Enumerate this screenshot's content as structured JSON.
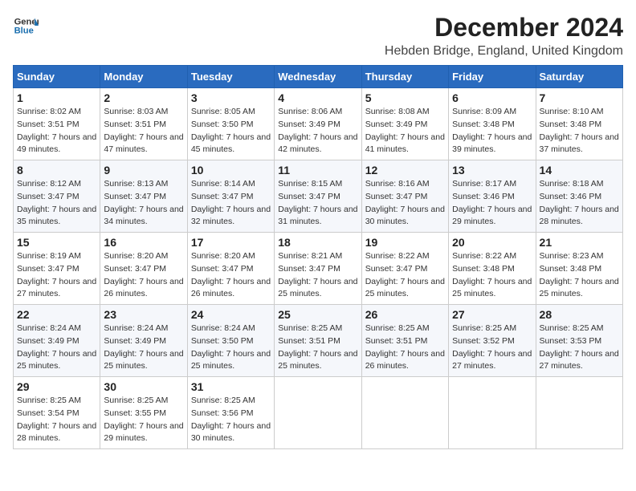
{
  "logo": {
    "line1": "General",
    "line2": "Blue"
  },
  "title": "December 2024",
  "subtitle": "Hebden Bridge, England, United Kingdom",
  "weekdays": [
    "Sunday",
    "Monday",
    "Tuesday",
    "Wednesday",
    "Thursday",
    "Friday",
    "Saturday"
  ],
  "weeks": [
    [
      {
        "day": "1",
        "sunrise": "8:02 AM",
        "sunset": "3:51 PM",
        "daylight": "7 hours and 49 minutes."
      },
      {
        "day": "2",
        "sunrise": "8:03 AM",
        "sunset": "3:51 PM",
        "daylight": "7 hours and 47 minutes."
      },
      {
        "day": "3",
        "sunrise": "8:05 AM",
        "sunset": "3:50 PM",
        "daylight": "7 hours and 45 minutes."
      },
      {
        "day": "4",
        "sunrise": "8:06 AM",
        "sunset": "3:49 PM",
        "daylight": "7 hours and 42 minutes."
      },
      {
        "day": "5",
        "sunrise": "8:08 AM",
        "sunset": "3:49 PM",
        "daylight": "7 hours and 41 minutes."
      },
      {
        "day": "6",
        "sunrise": "8:09 AM",
        "sunset": "3:48 PM",
        "daylight": "7 hours and 39 minutes."
      },
      {
        "day": "7",
        "sunrise": "8:10 AM",
        "sunset": "3:48 PM",
        "daylight": "7 hours and 37 minutes."
      }
    ],
    [
      {
        "day": "8",
        "sunrise": "8:12 AM",
        "sunset": "3:47 PM",
        "daylight": "7 hours and 35 minutes."
      },
      {
        "day": "9",
        "sunrise": "8:13 AM",
        "sunset": "3:47 PM",
        "daylight": "7 hours and 34 minutes."
      },
      {
        "day": "10",
        "sunrise": "8:14 AM",
        "sunset": "3:47 PM",
        "daylight": "7 hours and 32 minutes."
      },
      {
        "day": "11",
        "sunrise": "8:15 AM",
        "sunset": "3:47 PM",
        "daylight": "7 hours and 31 minutes."
      },
      {
        "day": "12",
        "sunrise": "8:16 AM",
        "sunset": "3:47 PM",
        "daylight": "7 hours and 30 minutes."
      },
      {
        "day": "13",
        "sunrise": "8:17 AM",
        "sunset": "3:46 PM",
        "daylight": "7 hours and 29 minutes."
      },
      {
        "day": "14",
        "sunrise": "8:18 AM",
        "sunset": "3:46 PM",
        "daylight": "7 hours and 28 minutes."
      }
    ],
    [
      {
        "day": "15",
        "sunrise": "8:19 AM",
        "sunset": "3:47 PM",
        "daylight": "7 hours and 27 minutes."
      },
      {
        "day": "16",
        "sunrise": "8:20 AM",
        "sunset": "3:47 PM",
        "daylight": "7 hours and 26 minutes."
      },
      {
        "day": "17",
        "sunrise": "8:20 AM",
        "sunset": "3:47 PM",
        "daylight": "7 hours and 26 minutes."
      },
      {
        "day": "18",
        "sunrise": "8:21 AM",
        "sunset": "3:47 PM",
        "daylight": "7 hours and 25 minutes."
      },
      {
        "day": "19",
        "sunrise": "8:22 AM",
        "sunset": "3:47 PM",
        "daylight": "7 hours and 25 minutes."
      },
      {
        "day": "20",
        "sunrise": "8:22 AM",
        "sunset": "3:48 PM",
        "daylight": "7 hours and 25 minutes."
      },
      {
        "day": "21",
        "sunrise": "8:23 AM",
        "sunset": "3:48 PM",
        "daylight": "7 hours and 25 minutes."
      }
    ],
    [
      {
        "day": "22",
        "sunrise": "8:24 AM",
        "sunset": "3:49 PM",
        "daylight": "7 hours and 25 minutes."
      },
      {
        "day": "23",
        "sunrise": "8:24 AM",
        "sunset": "3:49 PM",
        "daylight": "7 hours and 25 minutes."
      },
      {
        "day": "24",
        "sunrise": "8:24 AM",
        "sunset": "3:50 PM",
        "daylight": "7 hours and 25 minutes."
      },
      {
        "day": "25",
        "sunrise": "8:25 AM",
        "sunset": "3:51 PM",
        "daylight": "7 hours and 25 minutes."
      },
      {
        "day": "26",
        "sunrise": "8:25 AM",
        "sunset": "3:51 PM",
        "daylight": "7 hours and 26 minutes."
      },
      {
        "day": "27",
        "sunrise": "8:25 AM",
        "sunset": "3:52 PM",
        "daylight": "7 hours and 27 minutes."
      },
      {
        "day": "28",
        "sunrise": "8:25 AM",
        "sunset": "3:53 PM",
        "daylight": "7 hours and 27 minutes."
      }
    ],
    [
      {
        "day": "29",
        "sunrise": "8:25 AM",
        "sunset": "3:54 PM",
        "daylight": "7 hours and 28 minutes."
      },
      {
        "day": "30",
        "sunrise": "8:25 AM",
        "sunset": "3:55 PM",
        "daylight": "7 hours and 29 minutes."
      },
      {
        "day": "31",
        "sunrise": "8:25 AM",
        "sunset": "3:56 PM",
        "daylight": "7 hours and 30 minutes."
      },
      null,
      null,
      null,
      null
    ]
  ]
}
